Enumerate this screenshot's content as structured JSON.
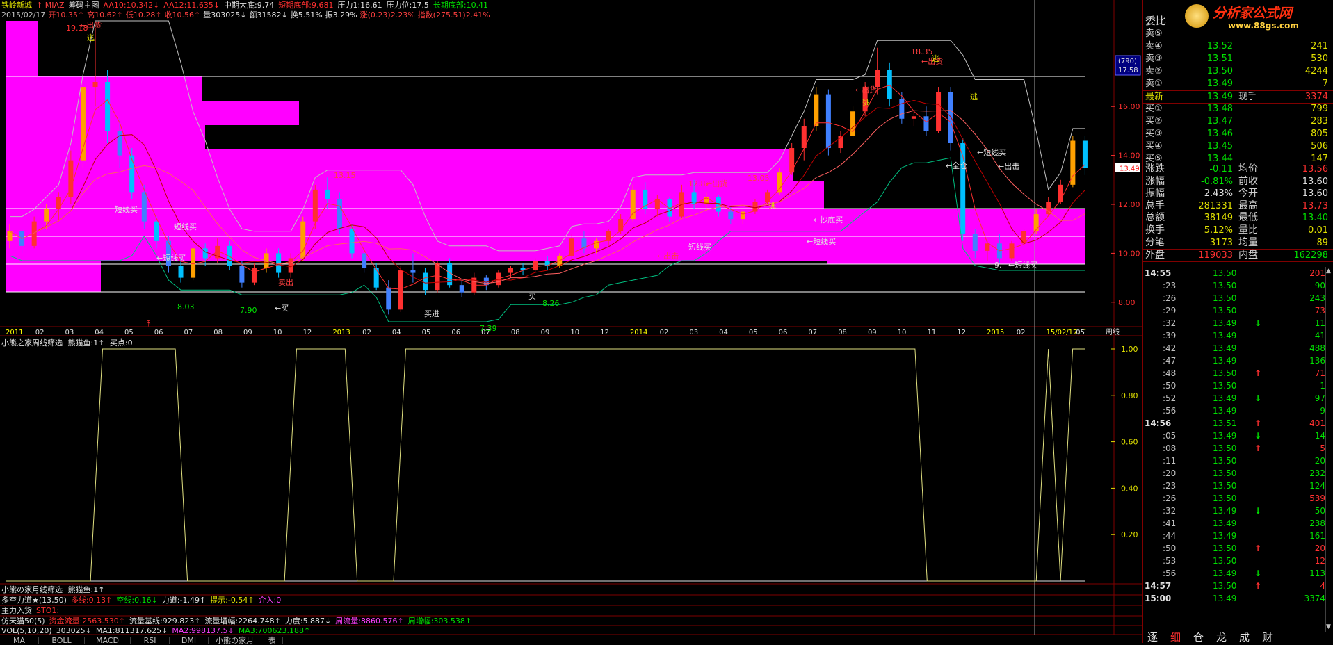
{
  "header": {
    "line1": [
      {
        "text": "铁岭新城",
        "color": "#e0e000"
      },
      {
        "text": "↑ MIAZ",
        "color": "#ff4040"
      },
      {
        "text": "筹码主图",
        "color": "#e0e0e0"
      },
      {
        "text": "AA10:10.342↓",
        "color": "#ff3030"
      },
      {
        "text": "AA12:11.635↓",
        "color": "#ff3030"
      },
      {
        "text": "中期大底:9.74",
        "color": "#e0e0e0"
      },
      {
        "text": "短期底部:9.681",
        "color": "#ff3030"
      },
      {
        "text": "压力1:16.61",
        "color": "#e0e0e0"
      },
      {
        "text": "压力位:17.5",
        "color": "#e0e0e0"
      },
      {
        "text": "长期底部:10.41",
        "color": "#00e000"
      }
    ],
    "line2": [
      {
        "text": "2015/02/17",
        "color": "#c0c0c0"
      },
      {
        "text": "开10.35↑",
        "color": "#ff4040"
      },
      {
        "text": "高10.62↑",
        "color": "#ff4040"
      },
      {
        "text": "低10.28↑",
        "color": "#ff4040"
      },
      {
        "text": "收10.56↑",
        "color": "#ff4040"
      },
      {
        "text": "量303025↓",
        "color": "#e0e0e0"
      },
      {
        "text": "额31582↓",
        "color": "#e0e0e0"
      },
      {
        "text": "换5.51%",
        "color": "#e0e0e0"
      },
      {
        "text": "振3.29%",
        "color": "#e0e0e0"
      },
      {
        "text": "涨(0.23)2.23%",
        "color": "#ff4040"
      },
      {
        "text": "指数(275.51)2.41%",
        "color": "#ff4040"
      }
    ]
  },
  "price_axis": [
    "16.00",
    "14.00",
    "12.00",
    "10.00",
    "8.00"
  ],
  "price_tag_current": "13.49",
  "price_tag_box": [
    "(790)",
    "17.58"
  ],
  "x_axis_labels": [
    "2011",
    "02",
    "03",
    "04",
    "05",
    "06",
    "07",
    "08",
    "09",
    "10",
    "12",
    "2013",
    "02",
    "04",
    "05",
    "06",
    "07",
    "08",
    "09",
    "10",
    "12",
    "2014",
    "02",
    "03",
    "04",
    "05",
    "06",
    "07",
    "08",
    "09",
    "10",
    "11",
    "12",
    "2015",
    "02",
    "15/02/17,二",
    "05",
    "周线"
  ],
  "chart_annotations": [
    "19.18",
    "←出货",
    "逃",
    "13.15",
    "12.82",
    "←出货",
    "13.05",
    "逃",
    "18.35",
    "←出货",
    "逃",
    "←出货",
    "逃",
    "逃",
    "←出击",
    "短线买",
    "←全仓",
    "←短线买",
    "短线买",
    "←买",
    "←短线买",
    "←抄底买",
    "←出击",
    "短线买",
    "8.03",
    "7.90",
    "7.39",
    "8.26",
    "9.",
    "←短线买",
    "←短线买",
    "买",
    "买进",
    "卖出",
    "$"
  ],
  "ind1": {
    "title": "小熊之家周线筛选",
    "title2": "熊猫鱼:1↑",
    "title3": "买点:0",
    "axis": [
      "1.00",
      "0.80",
      "0.60",
      "0.40",
      "0.20"
    ]
  },
  "ind2": {
    "title": "小熊の家月线筛选",
    "title2": "熊猫鱼:1↑"
  },
  "ind3": [
    {
      "text": "多空力道★(13,50)",
      "color": "#e0e0e0"
    },
    {
      "text": "多线:0.13↑",
      "color": "#ff3030"
    },
    {
      "text": "空线:0.16↓",
      "color": "#00e000"
    },
    {
      "text": "力道:-1.49↑",
      "color": "#e0e0e0"
    },
    {
      "text": "提示:-0.54↑",
      "color": "#e0e000"
    },
    {
      "text": "介入:0",
      "color": "#ff40ff"
    }
  ],
  "ind4": [
    {
      "text": "主力入货",
      "color": "#e0e0e0"
    },
    {
      "text": "STO1:",
      "color": "#ff3030"
    }
  ],
  "ind5": [
    {
      "text": "仿天猫50(5)",
      "color": "#e0e0e0"
    },
    {
      "text": "资金流量:2563.530↑",
      "color": "#ff3030"
    },
    {
      "text": "流量基线:929.823↑",
      "color": "#e0e0e0"
    },
    {
      "text": "流量增幅:2264.748↑",
      "color": "#e0e0e0"
    },
    {
      "text": "力度:5.887↓",
      "color": "#e0e0e0"
    },
    {
      "text": "周流量:8860.576↑",
      "color": "#ff40ff"
    },
    {
      "text": "周增幅:303.538↑",
      "color": "#00e000"
    }
  ],
  "ind6": [
    {
      "text": "VOL(5,10,20)",
      "color": "#e0e0e0"
    },
    {
      "text": "303025↓",
      "color": "#e0e0e0"
    },
    {
      "text": "MA1:811317.625↓",
      "color": "#e0e0e0"
    },
    {
      "text": "MA2:998137.5↓",
      "color": "#ff40ff"
    },
    {
      "text": "MA3:700623.188↑",
      "color": "#00e000"
    }
  ],
  "bottom_tabs": [
    "MA",
    "BOLL",
    "MACD",
    "RSI",
    "DMI",
    "小熊の家月",
    "表"
  ],
  "logo": {
    "text": "分析家公式网",
    "url": "www.88gs.com"
  },
  "order_book": {
    "header_label": "委比",
    "sells": [
      {
        "label": "卖⑤",
        "price": "",
        "vol": ""
      },
      {
        "label": "卖④",
        "price": "13.52",
        "vol": "241"
      },
      {
        "label": "卖③",
        "price": "13.51",
        "vol": "530"
      },
      {
        "label": "卖②",
        "price": "13.50",
        "vol": "4244"
      },
      {
        "label": "卖①",
        "price": "13.49",
        "vol": "7"
      }
    ],
    "latest": {
      "label": "最新",
      "price": "13.49",
      "label2": "现手",
      "vol": "3374"
    },
    "buys": [
      {
        "label": "买①",
        "price": "13.48",
        "vol": "799"
      },
      {
        "label": "买②",
        "price": "13.47",
        "vol": "283"
      },
      {
        "label": "买③",
        "price": "13.46",
        "vol": "805"
      },
      {
        "label": "买④",
        "price": "13.45",
        "vol": "506"
      },
      {
        "label": "买⑤",
        "price": "13.44",
        "vol": "147"
      }
    ]
  },
  "stats": [
    {
      "l1": "涨跌",
      "v1": "-0.11",
      "c1": "#00e000",
      "l2": "均价",
      "v2": "13.56",
      "c2": "#ff3030"
    },
    {
      "l1": "涨幅",
      "v1": "-0.81%",
      "c1": "#00e000",
      "l2": "前收",
      "v2": "13.60",
      "c2": "#e0e0e0"
    },
    {
      "l1": "振幅",
      "v1": "2.43%",
      "c1": "#e0e0e0",
      "l2": "今开",
      "v2": "13.60",
      "c2": "#e0e0e0"
    },
    {
      "l1": "总手",
      "v1": "281331",
      "c1": "#e0e000",
      "l2": "最高",
      "v2": "13.73",
      "c2": "#ff3030"
    },
    {
      "l1": "总额",
      "v1": "38149",
      "c1": "#e0e000",
      "l2": "最低",
      "v2": "13.40",
      "c2": "#00e000"
    },
    {
      "l1": "换手",
      "v1": "5.12%",
      "c1": "#e0e000",
      "l2": "量比",
      "v2": "0.01",
      "c2": "#e0e000"
    },
    {
      "l1": "分笔",
      "v1": "3173",
      "c1": "#e0e000",
      "l2": "均量",
      "v2": "89",
      "c2": "#e0e000"
    },
    {
      "l1": "外盘",
      "v1": "119033",
      "c1": "#ff3030",
      "l2": "内盘",
      "v2": "162298",
      "c2": "#00e000"
    }
  ],
  "ticks": [
    {
      "t": "14:55",
      "p": "13.50",
      "a": "",
      "v": "201",
      "vc": "#ff3030"
    },
    {
      "t": ":23",
      "p": "13.50",
      "a": "",
      "v": "90",
      "vc": "#00e000"
    },
    {
      "t": ":26",
      "p": "13.50",
      "a": "",
      "v": "243",
      "vc": "#00e000"
    },
    {
      "t": ":29",
      "p": "13.50",
      "a": "",
      "v": "73",
      "vc": "#ff3030"
    },
    {
      "t": ":32",
      "p": "13.49",
      "a": "↓",
      "v": "11",
      "vc": "#00e000"
    },
    {
      "t": ":39",
      "p": "13.49",
      "a": "",
      "v": "41",
      "vc": "#00e000"
    },
    {
      "t": ":42",
      "p": "13.49",
      "a": "",
      "v": "488",
      "vc": "#00e000"
    },
    {
      "t": ":47",
      "p": "13.49",
      "a": "",
      "v": "136",
      "vc": "#00e000"
    },
    {
      "t": ":48",
      "p": "13.50",
      "a": "↑",
      "v": "71",
      "vc": "#ff3030"
    },
    {
      "t": ":50",
      "p": "13.50",
      "a": "",
      "v": "1",
      "vc": "#00e000"
    },
    {
      "t": ":52",
      "p": "13.49",
      "a": "↓",
      "v": "97",
      "vc": "#00e000"
    },
    {
      "t": ":56",
      "p": "13.49",
      "a": "",
      "v": "9",
      "vc": "#00e000"
    },
    {
      "t": "14:56",
      "p": "13.51",
      "a": "↑",
      "v": "401",
      "vc": "#ff3030"
    },
    {
      "t": ":05",
      "p": "13.49",
      "a": "↓",
      "v": "14",
      "vc": "#00e000"
    },
    {
      "t": ":08",
      "p": "13.50",
      "a": "↑",
      "v": "5",
      "vc": "#ff3030"
    },
    {
      "t": ":11",
      "p": "13.50",
      "a": "",
      "v": "20",
      "vc": "#00e000"
    },
    {
      "t": ":20",
      "p": "13.50",
      "a": "",
      "v": "232",
      "vc": "#00e000"
    },
    {
      "t": ":23",
      "p": "13.50",
      "a": "",
      "v": "124",
      "vc": "#00e000"
    },
    {
      "t": ":26",
      "p": "13.50",
      "a": "",
      "v": "539",
      "vc": "#ff3030"
    },
    {
      "t": ":32",
      "p": "13.49",
      "a": "↓",
      "v": "50",
      "vc": "#00e000"
    },
    {
      "t": ":41",
      "p": "13.49",
      "a": "",
      "v": "238",
      "vc": "#00e000"
    },
    {
      "t": ":44",
      "p": "13.49",
      "a": "",
      "v": "161",
      "vc": "#00e000"
    },
    {
      "t": ":50",
      "p": "13.50",
      "a": "↑",
      "v": "20",
      "vc": "#ff3030"
    },
    {
      "t": ":53",
      "p": "13.50",
      "a": "",
      "v": "12",
      "vc": "#ff3030"
    },
    {
      "t": ":56",
      "p": "13.49",
      "a": "↓",
      "v": "113",
      "vc": "#00e000"
    },
    {
      "t": "14:57",
      "p": "13.50",
      "a": "↑",
      "v": "4",
      "vc": "#ff3030"
    },
    {
      "t": "15:00",
      "p": "13.49",
      "a": "",
      "v": "3374",
      "vc": "#00e000"
    }
  ],
  "side_tabs": [
    "逐",
    "细",
    "仓",
    "龙",
    "成",
    "财"
  ],
  "candles": [
    [
      10.5,
      11.2,
      10.2,
      10.9
    ],
    [
      10.9,
      11.0,
      10.0,
      10.3
    ],
    [
      10.3,
      11.5,
      10.2,
      11.3
    ],
    [
      11.3,
      12.0,
      11.0,
      11.8
    ],
    [
      11.8,
      12.5,
      11.3,
      12.3
    ],
    [
      12.3,
      14.2,
      12.0,
      13.8
    ],
    [
      13.8,
      17.0,
      13.5,
      16.8
    ],
    [
      16.8,
      19.2,
      16.0,
      17.0
    ],
    [
      17.0,
      17.5,
      14.5,
      15.0
    ],
    [
      15.0,
      15.5,
      13.5,
      14.0
    ],
    [
      14.0,
      14.3,
      12.2,
      12.5
    ],
    [
      12.5,
      12.8,
      11.0,
      11.3
    ],
    [
      11.3,
      11.5,
      10.2,
      10.5
    ],
    [
      10.5,
      10.7,
      9.2,
      9.5
    ],
    [
      9.5,
      9.8,
      8.8,
      9.0
    ],
    [
      9.0,
      10.5,
      8.9,
      10.2
    ],
    [
      10.2,
      10.4,
      9.5,
      9.8
    ],
    [
      9.8,
      10.6,
      9.6,
      10.3
    ],
    [
      10.3,
      10.5,
      9.3,
      9.5
    ],
    [
      9.5,
      9.7,
      8.6,
      8.8
    ],
    [
      8.8,
      9.6,
      8.7,
      9.4
    ],
    [
      9.4,
      10.2,
      9.2,
      10.0
    ],
    [
      10.0,
      10.2,
      9.0,
      9.2
    ],
    [
      9.2,
      10.0,
      9.0,
      9.8
    ],
    [
      9.8,
      11.5,
      9.7,
      11.3
    ],
    [
      11.3,
      12.8,
      11.0,
      12.6
    ],
    [
      12.6,
      13.1,
      11.8,
      12.2
    ],
    [
      12.2,
      12.5,
      10.8,
      11.0
    ],
    [
      11.0,
      11.2,
      9.8,
      10.0
    ],
    [
      10.0,
      10.2,
      9.2,
      9.4
    ],
    [
      9.4,
      9.6,
      8.5,
      8.6
    ],
    [
      8.6,
      8.9,
      7.5,
      7.7
    ],
    [
      7.7,
      9.5,
      7.6,
      9.3
    ],
    [
      9.3,
      10.0,
      8.8,
      9.2
    ],
    [
      9.2,
      9.4,
      8.3,
      8.5
    ],
    [
      8.5,
      9.7,
      8.4,
      9.6
    ],
    [
      9.6,
      9.8,
      8.6,
      8.7
    ],
    [
      8.7,
      8.9,
      8.2,
      8.4
    ],
    [
      8.4,
      9.2,
      8.3,
      9.0
    ],
    [
      9.0,
      9.1,
      8.5,
      8.7
    ],
    [
      8.7,
      9.3,
      8.6,
      9.2
    ],
    [
      9.2,
      9.5,
      9.0,
      9.4
    ],
    [
      9.4,
      9.6,
      9.1,
      9.3
    ],
    [
      9.3,
      9.8,
      9.2,
      9.7
    ],
    [
      9.7,
      9.9,
      9.3,
      9.5
    ],
    [
      9.5,
      10.0,
      9.4,
      9.9
    ],
    [
      9.9,
      10.8,
      9.8,
      10.6
    ],
    [
      10.6,
      10.9,
      10.0,
      10.2
    ],
    [
      10.2,
      10.6,
      10.0,
      10.5
    ],
    [
      10.5,
      11.0,
      10.3,
      10.9
    ],
    [
      10.9,
      11.6,
      10.8,
      11.4
    ],
    [
      11.4,
      12.8,
      11.3,
      12.6
    ],
    [
      12.6,
      12.9,
      11.6,
      11.8
    ],
    [
      11.8,
      12.4,
      11.5,
      12.2
    ],
    [
      12.2,
      12.3,
      11.3,
      11.5
    ],
    [
      11.5,
      12.8,
      11.4,
      12.5
    ],
    [
      12.5,
      13.0,
      11.8,
      12.0
    ],
    [
      12.0,
      12.5,
      11.7,
      12.3
    ],
    [
      12.3,
      12.4,
      11.5,
      11.7
    ],
    [
      11.7,
      11.9,
      11.2,
      11.4
    ],
    [
      11.4,
      11.8,
      11.2,
      11.7
    ],
    [
      11.7,
      12.2,
      11.6,
      12.1
    ],
    [
      12.1,
      12.6,
      12.0,
      12.5
    ],
    [
      12.5,
      13.5,
      12.4,
      13.3
    ],
    [
      13.3,
      14.5,
      13.2,
      14.3
    ],
    [
      14.3,
      15.5,
      13.8,
      15.2
    ],
    [
      15.2,
      16.8,
      15.0,
      16.5
    ],
    [
      16.5,
      16.7,
      14.0,
      14.3
    ],
    [
      14.3,
      15.0,
      14.1,
      14.8
    ],
    [
      14.8,
      16.0,
      14.7,
      15.8
    ],
    [
      15.8,
      17.0,
      15.6,
      16.8
    ],
    [
      16.8,
      18.4,
      16.5,
      17.5
    ],
    [
      17.5,
      17.8,
      16.0,
      16.3
    ],
    [
      16.3,
      16.6,
      15.3,
      15.5
    ],
    [
      15.5,
      15.8,
      15.2,
      15.6
    ],
    [
      15.6,
      16.0,
      14.8,
      15.0
    ],
    [
      15.0,
      16.8,
      14.9,
      16.6
    ],
    [
      16.6,
      16.8,
      14.2,
      14.5
    ],
    [
      14.5,
      14.7,
      10.5,
      10.8
    ],
    [
      10.8,
      11.0,
      9.8,
      10.1
    ],
    [
      10.1,
      10.5,
      9.7,
      10.4
    ],
    [
      10.4,
      10.8,
      9.6,
      9.8
    ],
    [
      9.8,
      10.5,
      9.7,
      10.4
    ],
    [
      10.4,
      11.0,
      10.3,
      10.9
    ],
    [
      10.9,
      11.8,
      10.8,
      11.6
    ],
    [
      11.6,
      12.3,
      11.5,
      12.1
    ],
    [
      12.1,
      13.0,
      12.0,
      12.8
    ],
    [
      12.8,
      14.8,
      12.7,
      14.6
    ],
    [
      14.6,
      14.8,
      13.2,
      13.49
    ]
  ],
  "ind1_signal": [
    0,
    0,
    0,
    0,
    0,
    0,
    0,
    0,
    1,
    1,
    1,
    1,
    1,
    1,
    1,
    0,
    0,
    0,
    0,
    0,
    0,
    0,
    0,
    0,
    1,
    1,
    1,
    1,
    1,
    0,
    0,
    0,
    0,
    1,
    1,
    1,
    1,
    1,
    1,
    1,
    1,
    1,
    1,
    1,
    1,
    1,
    1,
    1,
    1,
    1,
    1,
    1,
    1,
    1,
    1,
    1,
    1,
    1,
    1,
    1,
    1,
    1,
    1,
    1,
    1,
    1,
    1,
    1,
    1,
    1,
    1,
    1,
    1,
    1,
    1,
    1,
    0,
    0,
    0,
    0,
    0,
    0,
    0,
    0,
    0,
    0,
    1,
    0,
    1,
    1
  ]
}
